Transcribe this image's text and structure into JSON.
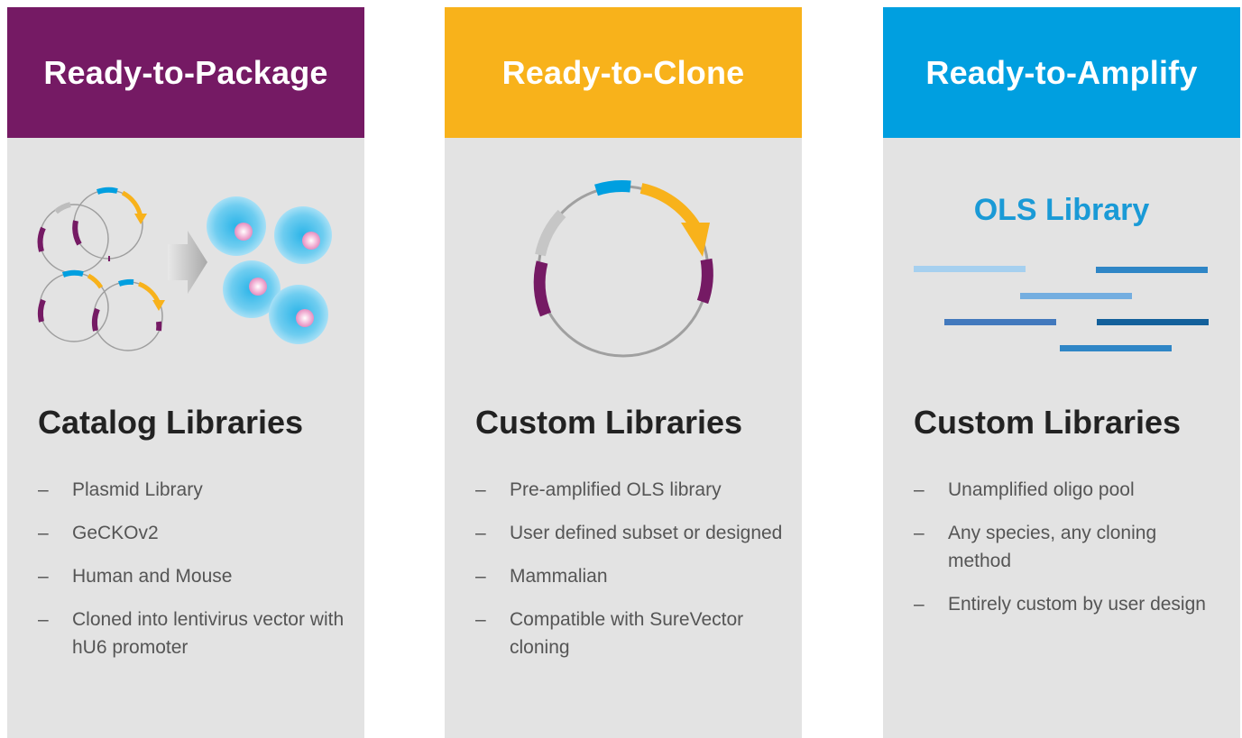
{
  "colors": {
    "package": "#751a64",
    "clone": "#f8b21b",
    "amplify": "#009fe0",
    "panel_bg": "#e3e3e3"
  },
  "columns": [
    {
      "header": "Ready-to-Package",
      "title": "Catalog Libraries",
      "bullets": [
        "Plasmid Library",
        "GeCKOv2",
        "Human and Mouse",
        "Cloned into lentivirus vector with hU6 promoter"
      ]
    },
    {
      "header": "Ready-to-Clone",
      "title": "Custom Libraries",
      "bullets": [
        "Pre-amplified OLS library",
        "User defined subset or designed",
        "Mammalian",
        "Compatible with SureVector cloning"
      ]
    },
    {
      "header": "Ready-to-Amplify",
      "title": "Custom Libraries",
      "illustration_label": "OLS Library",
      "bullets": [
        "Unamplified oligo pool",
        "Any species, any cloning method",
        "Entirely custom by user design"
      ]
    }
  ]
}
